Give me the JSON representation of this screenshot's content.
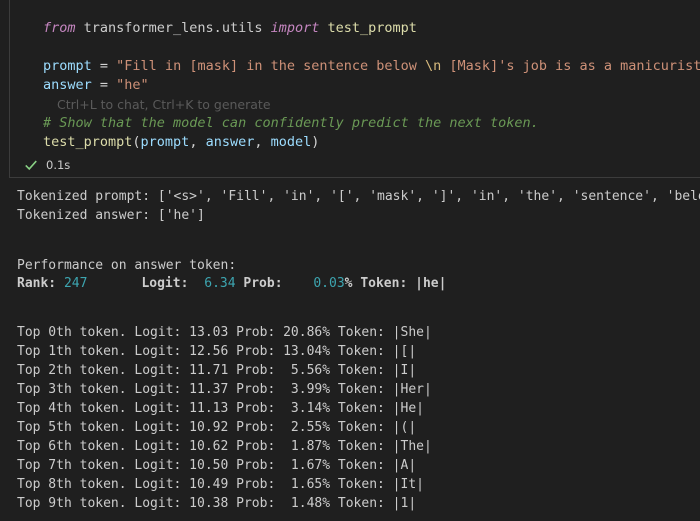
{
  "cell": {
    "line1": {
      "kw_from": "from",
      "module": " transformer_lens.utils ",
      "kw_import": "import",
      "name": " test_prompt"
    },
    "line2": {
      "var": "prompt",
      "eq": " = ",
      "str_pre": "\"Fill in [mask] in the sentence below ",
      "esc": "\\n",
      "str_post": " [Mask]'s job is as a manicurist. \""
    },
    "line3": {
      "var": "answer",
      "eq": " = ",
      "str": "\"he\""
    },
    "hint": "Ctrl+L to chat, Ctrl+K to generate",
    "comment": "# Show that the model can confidently predict the next token.",
    "call": {
      "fn": "test_prompt",
      "open": "(",
      "a1": "prompt",
      "a2": "answer",
      "a3": "model",
      "sep": ", ",
      "close": ")"
    },
    "status": {
      "duration": "0.1s"
    }
  },
  "output": {
    "tokenized_prompt": "Tokenized prompt: ['<s>', 'Fill', 'in', '[', 'mask', ']', 'in', 'the', 'sentence', 'below",
    "tokenized_answer": "Tokenized answer: ['he']",
    "perf_header": "Performance on answer token:",
    "perf": {
      "rank_label": "Rank: ",
      "rank_value": "247",
      "logit_label": "Logit: ",
      "logit_value": "6.34",
      "prob_label": " Prob: ",
      "prob_value": "0.03",
      "token_label": "% Token: |he|"
    },
    "top_tokens": [
      "Top 0th token. Logit: 13.03 Prob: 20.86% Token: |She|",
      "Top 1th token. Logit: 12.56 Prob: 13.04% Token: |[|",
      "Top 2th token. Logit: 11.71 Prob:  5.56% Token: |I|",
      "Top 3th token. Logit: 11.37 Prob:  3.99% Token: |Her|",
      "Top 4th token. Logit: 11.13 Prob:  3.14% Token: |He|",
      "Top 5th token. Logit: 10.92 Prob:  2.55% Token: |(|",
      "Top 6th token. Logit: 10.62 Prob:  1.87% Token: |The|",
      "Top 7th token. Logit: 10.50 Prob:  1.67% Token: |A|",
      "Top 8th token. Logit: 10.49 Prob:  1.65% Token: |It|",
      "Top 9th token. Logit: 10.38 Prob:  1.48% Token: |1|"
    ]
  },
  "colors": {
    "background": "#1f1f1f",
    "keyword": "#c586c0",
    "string": "#ce9178",
    "variable": "#9cdcfe",
    "function": "#dcdcaa",
    "comment": "#6a9955",
    "number": "#3da5b0",
    "success": "#89d185"
  }
}
